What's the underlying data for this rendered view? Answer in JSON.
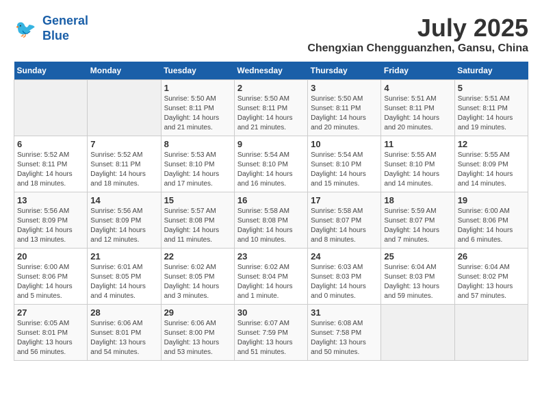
{
  "logo": {
    "line1": "General",
    "line2": "Blue"
  },
  "title": "July 2025",
  "location": "Chengxian Chengguanzhen, Gansu, China",
  "weekdays": [
    "Sunday",
    "Monday",
    "Tuesday",
    "Wednesday",
    "Thursday",
    "Friday",
    "Saturday"
  ],
  "weeks": [
    [
      {
        "day": "",
        "info": ""
      },
      {
        "day": "",
        "info": ""
      },
      {
        "day": "1",
        "sunrise": "5:50 AM",
        "sunset": "8:11 PM",
        "daylight": "14 hours and 21 minutes."
      },
      {
        "day": "2",
        "sunrise": "5:50 AM",
        "sunset": "8:11 PM",
        "daylight": "14 hours and 21 minutes."
      },
      {
        "day": "3",
        "sunrise": "5:50 AM",
        "sunset": "8:11 PM",
        "daylight": "14 hours and 20 minutes."
      },
      {
        "day": "4",
        "sunrise": "5:51 AM",
        "sunset": "8:11 PM",
        "daylight": "14 hours and 20 minutes."
      },
      {
        "day": "5",
        "sunrise": "5:51 AM",
        "sunset": "8:11 PM",
        "daylight": "14 hours and 19 minutes."
      }
    ],
    [
      {
        "day": "6",
        "sunrise": "5:52 AM",
        "sunset": "8:11 PM",
        "daylight": "14 hours and 18 minutes."
      },
      {
        "day": "7",
        "sunrise": "5:52 AM",
        "sunset": "8:11 PM",
        "daylight": "14 hours and 18 minutes."
      },
      {
        "day": "8",
        "sunrise": "5:53 AM",
        "sunset": "8:10 PM",
        "daylight": "14 hours and 17 minutes."
      },
      {
        "day": "9",
        "sunrise": "5:54 AM",
        "sunset": "8:10 PM",
        "daylight": "14 hours and 16 minutes."
      },
      {
        "day": "10",
        "sunrise": "5:54 AM",
        "sunset": "8:10 PM",
        "daylight": "14 hours and 15 minutes."
      },
      {
        "day": "11",
        "sunrise": "5:55 AM",
        "sunset": "8:10 PM",
        "daylight": "14 hours and 14 minutes."
      },
      {
        "day": "12",
        "sunrise": "5:55 AM",
        "sunset": "8:09 PM",
        "daylight": "14 hours and 14 minutes."
      }
    ],
    [
      {
        "day": "13",
        "sunrise": "5:56 AM",
        "sunset": "8:09 PM",
        "daylight": "14 hours and 13 minutes."
      },
      {
        "day": "14",
        "sunrise": "5:56 AM",
        "sunset": "8:09 PM",
        "daylight": "14 hours and 12 minutes."
      },
      {
        "day": "15",
        "sunrise": "5:57 AM",
        "sunset": "8:08 PM",
        "daylight": "14 hours and 11 minutes."
      },
      {
        "day": "16",
        "sunrise": "5:58 AM",
        "sunset": "8:08 PM",
        "daylight": "14 hours and 10 minutes."
      },
      {
        "day": "17",
        "sunrise": "5:58 AM",
        "sunset": "8:07 PM",
        "daylight": "14 hours and 8 minutes."
      },
      {
        "day": "18",
        "sunrise": "5:59 AM",
        "sunset": "8:07 PM",
        "daylight": "14 hours and 7 minutes."
      },
      {
        "day": "19",
        "sunrise": "6:00 AM",
        "sunset": "8:06 PM",
        "daylight": "14 hours and 6 minutes."
      }
    ],
    [
      {
        "day": "20",
        "sunrise": "6:00 AM",
        "sunset": "8:06 PM",
        "daylight": "14 hours and 5 minutes."
      },
      {
        "day": "21",
        "sunrise": "6:01 AM",
        "sunset": "8:05 PM",
        "daylight": "14 hours and 4 minutes."
      },
      {
        "day": "22",
        "sunrise": "6:02 AM",
        "sunset": "8:05 PM",
        "daylight": "14 hours and 3 minutes."
      },
      {
        "day": "23",
        "sunrise": "6:02 AM",
        "sunset": "8:04 PM",
        "daylight": "14 hours and 1 minute."
      },
      {
        "day": "24",
        "sunrise": "6:03 AM",
        "sunset": "8:03 PM",
        "daylight": "14 hours and 0 minutes."
      },
      {
        "day": "25",
        "sunrise": "6:04 AM",
        "sunset": "8:03 PM",
        "daylight": "13 hours and 59 minutes."
      },
      {
        "day": "26",
        "sunrise": "6:04 AM",
        "sunset": "8:02 PM",
        "daylight": "13 hours and 57 minutes."
      }
    ],
    [
      {
        "day": "27",
        "sunrise": "6:05 AM",
        "sunset": "8:01 PM",
        "daylight": "13 hours and 56 minutes."
      },
      {
        "day": "28",
        "sunrise": "6:06 AM",
        "sunset": "8:01 PM",
        "daylight": "13 hours and 54 minutes."
      },
      {
        "day": "29",
        "sunrise": "6:06 AM",
        "sunset": "8:00 PM",
        "daylight": "13 hours and 53 minutes."
      },
      {
        "day": "30",
        "sunrise": "6:07 AM",
        "sunset": "7:59 PM",
        "daylight": "13 hours and 51 minutes."
      },
      {
        "day": "31",
        "sunrise": "6:08 AM",
        "sunset": "7:58 PM",
        "daylight": "13 hours and 50 minutes."
      },
      {
        "day": "",
        "info": ""
      },
      {
        "day": "",
        "info": ""
      }
    ]
  ],
  "labels": {
    "sunrise": "Sunrise:",
    "sunset": "Sunset:",
    "daylight": "Daylight:"
  }
}
